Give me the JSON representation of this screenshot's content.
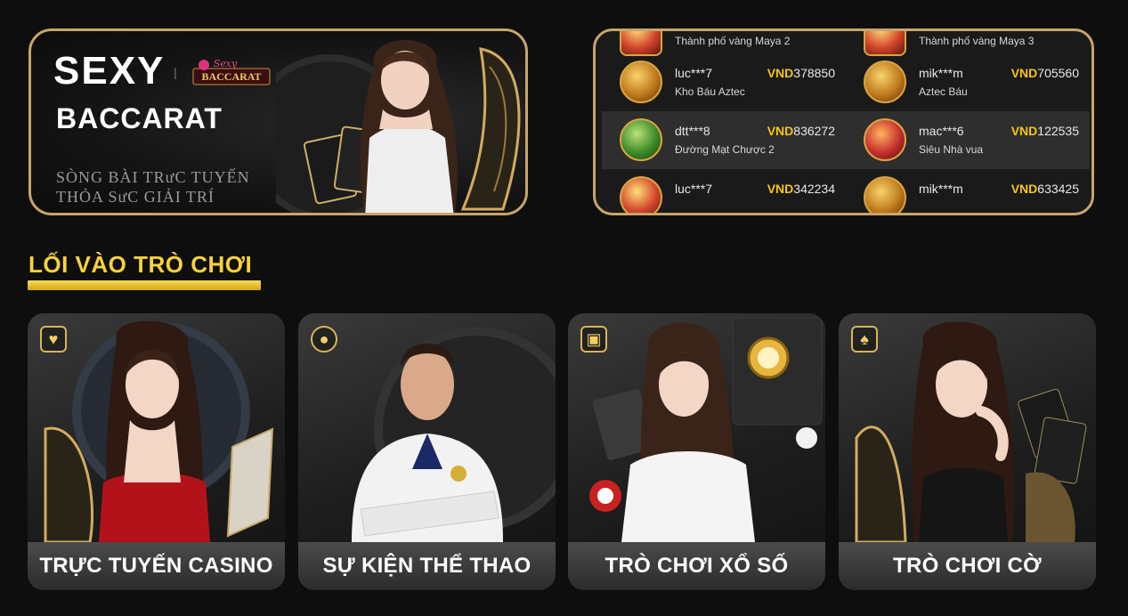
{
  "banner": {
    "title_line1": "SEXY",
    "logo_script": "Sexy",
    "logo_text": "BACCARAT",
    "title_line2": "BACCARAT",
    "subtitle_line1": "SÒNG BÀI TRưC TUYẾN",
    "subtitle_line2": "THỎA SưC GIẢI TRÍ"
  },
  "winners": {
    "currency": "VND",
    "rows": [
      {
        "left": {
          "user": "",
          "game": "Thành phố vàng Maya 2",
          "amount": ""
        },
        "right": {
          "user": "",
          "game": "Thành phố vàng Maya 3",
          "amount": ""
        }
      },
      {
        "left": {
          "user": "luc***7",
          "game": "Kho Báu Aztec",
          "amount": "378850"
        },
        "right": {
          "user": "mik***m",
          "game": "Aztec Báu",
          "amount": "705560"
        }
      },
      {
        "left": {
          "user": "dtt***8",
          "game": "Đường Mạt Chược 2",
          "amount": "836272"
        },
        "right": {
          "user": "mac***6",
          "game": "Siêu Nhà vua",
          "amount": "122535"
        }
      },
      {
        "left": {
          "user": "luc***7",
          "game": "",
          "amount": "342234"
        },
        "right": {
          "user": "mik***m",
          "game": "",
          "amount": "633425"
        }
      }
    ]
  },
  "section": {
    "title": "LỐI VÀO TRÒ CHƠI"
  },
  "categories": [
    {
      "label": "TRỰC TUYẾN CASINO",
      "icon": "cards-heart-icon"
    },
    {
      "label": "SỰ KIỆN THỂ THAO",
      "icon": "basketball-icon"
    },
    {
      "label": "TRÒ CHƠI XỔ SỐ",
      "icon": "lottery-ticket-icon"
    },
    {
      "label": "TRÒ CHƠI CỜ",
      "icon": "playing-cards-icon"
    }
  ],
  "colors": {
    "gold_border": "#c8a56a",
    "heading_yellow": "#f7d23b",
    "currency": "#f5c518",
    "background": "#0e0e0e"
  }
}
